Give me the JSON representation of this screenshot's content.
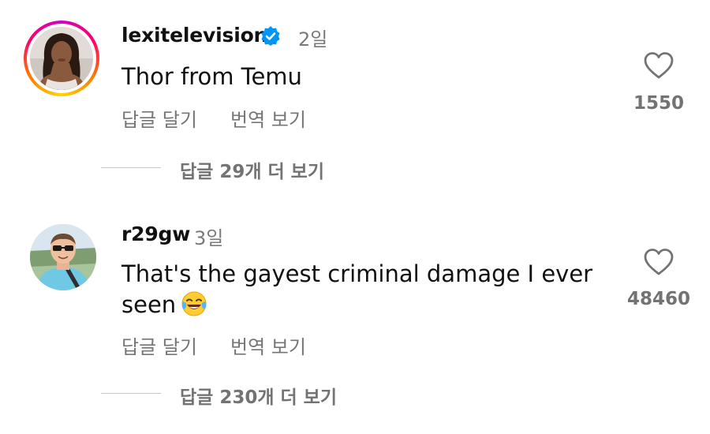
{
  "comments": [
    {
      "username": "lexitelevision",
      "verified": true,
      "time": "2일",
      "text": "Thor from Temu",
      "reply_label": "답글 달기",
      "translate_label": "번역 보기",
      "likes": "1550",
      "view_replies": "답글 29개 더 보기",
      "has_story_ring": true
    },
    {
      "username": "r29gw",
      "verified": false,
      "time": "3일",
      "text_line1": "That's the gayest criminal damage I ever",
      "text_line2": "seen",
      "emoji": "face-with-tears-of-joy-emoji",
      "reply_label": "답글 달기",
      "translate_label": "번역 보기",
      "likes": "48460",
      "view_replies": "답글 230개 더 보기",
      "has_story_ring": false
    }
  ],
  "colors": {
    "primary_text": "#111111",
    "secondary_text": "#757575",
    "verified_blue": "#0095f6",
    "story_ring": [
      "#d300c5",
      "#ff0069",
      "#ff7a00",
      "#ffd600"
    ]
  },
  "icons": {
    "like": "heart-outline-icon",
    "verified": "verified-badge-icon"
  }
}
